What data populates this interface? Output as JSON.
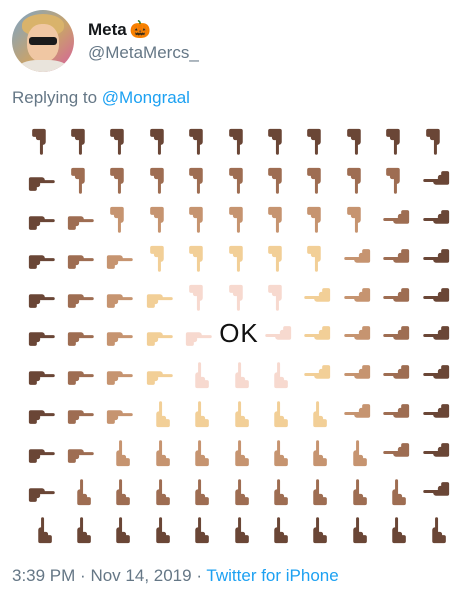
{
  "user": {
    "display_name": "Meta",
    "emoji": "🎃",
    "handle": "@MetaMercs_"
  },
  "reply": {
    "prefix": "Replying to",
    "mention": "@Mongraal"
  },
  "center_text": "OK",
  "footer": {
    "time": "3:39 PM",
    "date": "Nov 14, 2019",
    "separator": "·",
    "source": "Twitter for iPhone"
  },
  "skin_tones": [
    "#6a4636",
    "#9e6d52",
    "#c69470",
    "#f2cf97",
    "#f7d9cf"
  ]
}
